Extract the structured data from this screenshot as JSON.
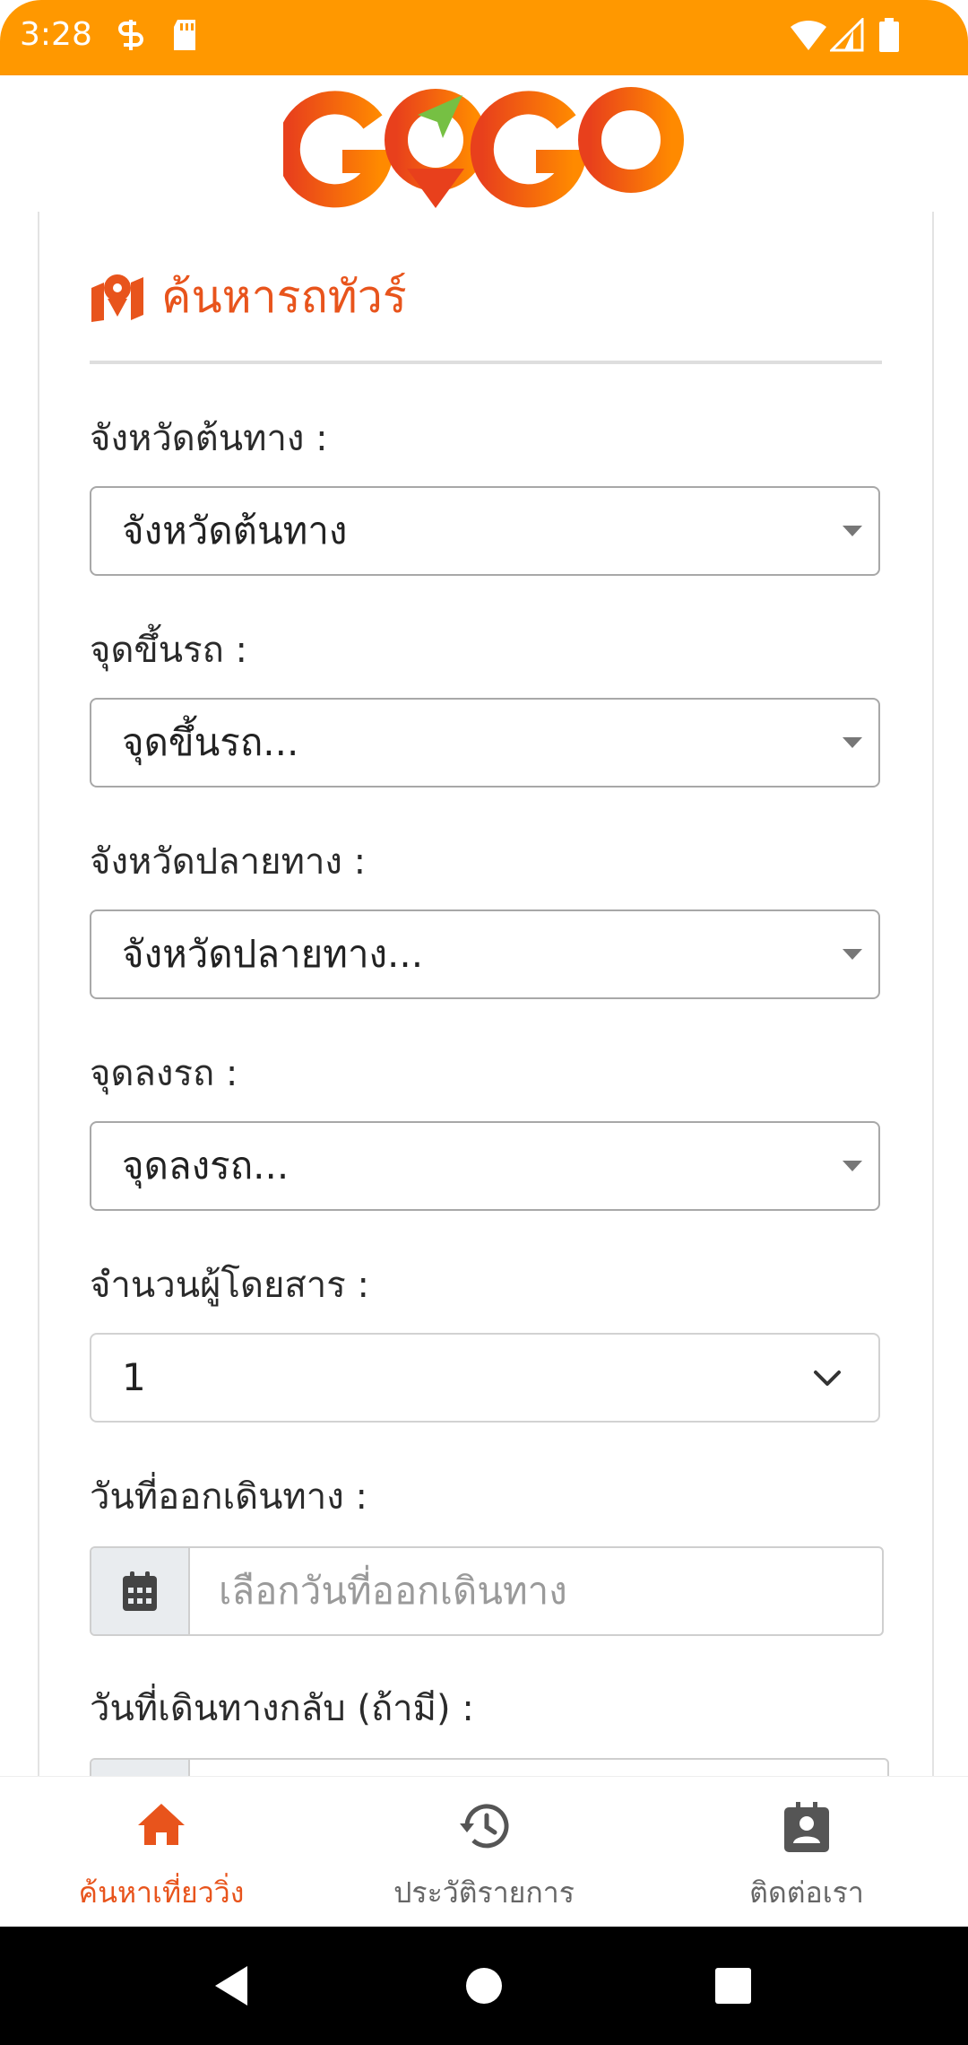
{
  "status_bar": {
    "time": "3:28"
  },
  "header": {
    "logo_text": "GOGO",
    "brand_colors": [
      "#e8541c",
      "#ff8a00",
      "#76c043"
    ]
  },
  "card": {
    "title": "ค้นหารถทัวร์",
    "title_icon": "map-icon"
  },
  "form": {
    "origin_province": {
      "label": "จังหวัดต้นทาง :",
      "value": "จังหวัดต้นทาง"
    },
    "pickup_point": {
      "label": "จุดขึ้นรถ :",
      "value": "จุดขึ้นรถ..."
    },
    "destination_province": {
      "label": "จังหวัดปลายทาง :",
      "value": "จังหวัดปลายทาง..."
    },
    "dropoff_point": {
      "label": "จุดลงรถ :",
      "value": "จุดลงรถ..."
    },
    "passengers": {
      "label": "จำนวนผู้โดยสาร :",
      "value": "1"
    },
    "departure_date": {
      "label": "วันที่ออกเดินทาง :",
      "placeholder": "เลือกวันที่ออกเดินทาง"
    },
    "return_date": {
      "label": "วันที่เดินทางกลับ (ถ้ามี) :"
    }
  },
  "bottom_nav": {
    "items": [
      {
        "label": "ค้นหาเที่ยววิ่ง",
        "icon": "home-icon",
        "active": true
      },
      {
        "label": "ประวัติรายการ",
        "icon": "history-icon",
        "active": false
      },
      {
        "label": "ติดต่อเรา",
        "icon": "contact-icon",
        "active": false
      }
    ]
  },
  "colors": {
    "status_bar": "#ff9800",
    "accent": "#e8541c"
  }
}
